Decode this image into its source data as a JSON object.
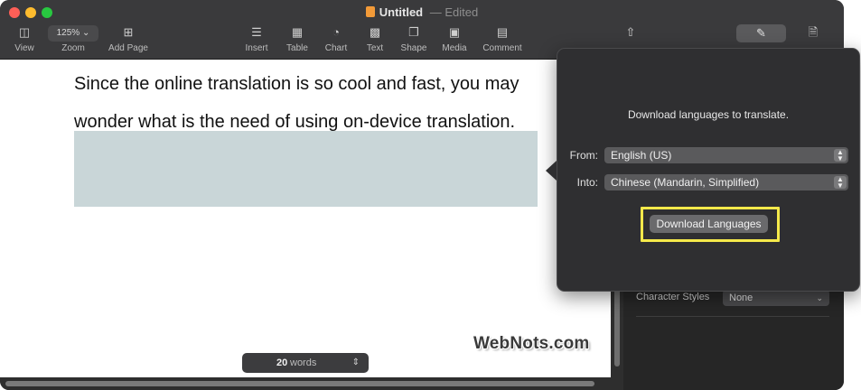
{
  "window": {
    "title": "Untitled",
    "title_separator": "—",
    "status": "Edited"
  },
  "toolbar": {
    "view": "View",
    "zoom_value": "125%",
    "zoom_label": "Zoom",
    "add_page": "Add Page",
    "insert": "Insert",
    "table": "Table",
    "chart": "Chart",
    "text": "Text",
    "shape": "Shape",
    "media": "Media",
    "comment": "Comment"
  },
  "document": {
    "line1": "Since the online translation is so cool and fast, you may",
    "line2": "wonder what is the need of using on-device translation."
  },
  "word_count": {
    "count": "20",
    "unit": "words"
  },
  "sidebar": {
    "character_styles_label": "Character Styles",
    "character_styles_value": "None"
  },
  "popover": {
    "message": "Download languages to translate.",
    "from_label": "From:",
    "from_value": "English (US)",
    "into_label": "Into:",
    "into_value": "Chinese (Mandarin, Simplified)",
    "download_button": "Download Languages"
  },
  "watermark": "WebNots.com",
  "colors": {
    "highlight": "#f5e94a",
    "selection": "#c9d6d8"
  }
}
